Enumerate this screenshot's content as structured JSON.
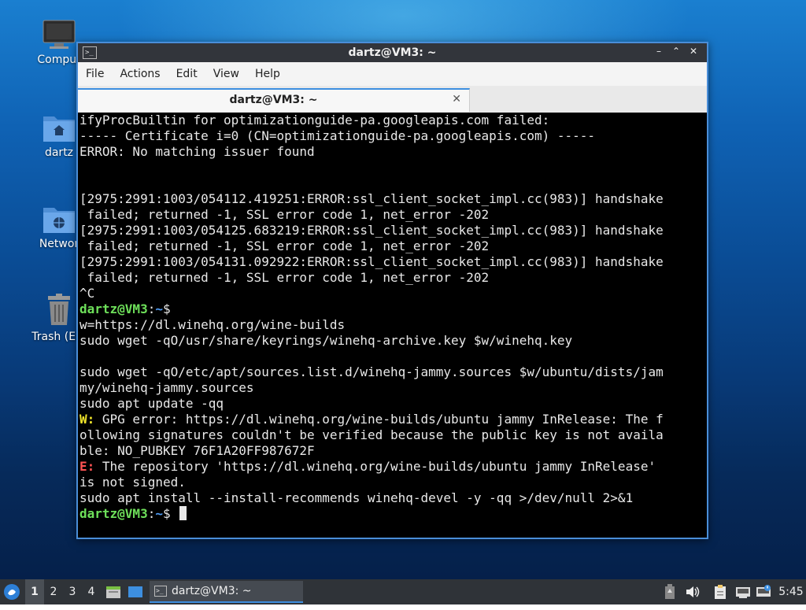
{
  "desktop": {
    "icons": [
      {
        "label": "Comput",
        "icon": "computer-icon"
      },
      {
        "label": "dartz",
        "icon": "home-folder-icon"
      },
      {
        "label": "Networ",
        "icon": "network-folder-icon"
      },
      {
        "label": "Trash (Em",
        "icon": "trash-icon"
      }
    ]
  },
  "window": {
    "title": "dartz@VM3: ~",
    "controls": {
      "minimize": "–",
      "maximize": "⌃",
      "close": "✕"
    },
    "icon_glyph": ">_"
  },
  "menubar": {
    "items": [
      "File",
      "Actions",
      "Edit",
      "View",
      "Help"
    ]
  },
  "tab": {
    "label": "dartz@VM3: ~",
    "close_glyph": "✕"
  },
  "terminal": {
    "prompt_user": "dartz@VM3",
    "prompt_sep": ":",
    "prompt_path": "~",
    "prompt_dollar": "$",
    "lines": [
      "ifyProcBuiltin for optimizationguide-pa.googleapis.com failed:",
      "----- Certificate i=0 (CN=optimizationguide-pa.googleapis.com) -----",
      "ERROR: No matching issuer found",
      "",
      "",
      "[2975:2991:1003/054112.419251:ERROR:ssl_client_socket_impl.cc(983)] handshake",
      " failed; returned -1, SSL error code 1, net_error -202",
      "[2975:2991:1003/054125.683219:ERROR:ssl_client_socket_impl.cc(983)] handshake",
      " failed; returned -1, SSL error code 1, net_error -202",
      "[2975:2991:1003/054131.092922:ERROR:ssl_client_socket_impl.cc(983)] handshake",
      " failed; returned -1, SSL error code 1, net_error -202",
      "^C"
    ],
    "commands": [
      "w=https://dl.winehq.org/wine-builds",
      "sudo wget -qO/usr/share/keyrings/winehq-archive.key $w/winehq.key",
      "",
      "sudo wget -qO/etc/apt/sources.list.d/winehq-jammy.sources $w/ubuntu/dists/jam",
      "my/winehq-jammy.sources",
      "sudo apt update -qq"
    ],
    "warn_tag": "W:",
    "warn_lines": [
      " GPG error: https://dl.winehq.org/wine-builds/ubuntu jammy InRelease: The f",
      "ollowing signatures couldn't be verified because the public key is not availa",
      "ble: NO_PUBKEY 76F1A20FF987672F"
    ],
    "err_tag": "E:",
    "err_lines": [
      " The repository 'https://dl.winehq.org/wine-builds/ubuntu jammy InRelease'",
      "is not signed."
    ],
    "final_command": "sudo apt install --install-recommends winehq-devel -y -qq >/dev/null 2>&1"
  },
  "taskbar": {
    "workspaces": [
      "1",
      "2",
      "3",
      "4"
    ],
    "active_workspace": "1",
    "task_label": "dartz@VM3: ~",
    "clock": "5:45",
    "tray_icons": [
      "battery-icon",
      "volume-icon",
      "clipboard-icon",
      "network-icon",
      "update-notifier-icon"
    ]
  }
}
